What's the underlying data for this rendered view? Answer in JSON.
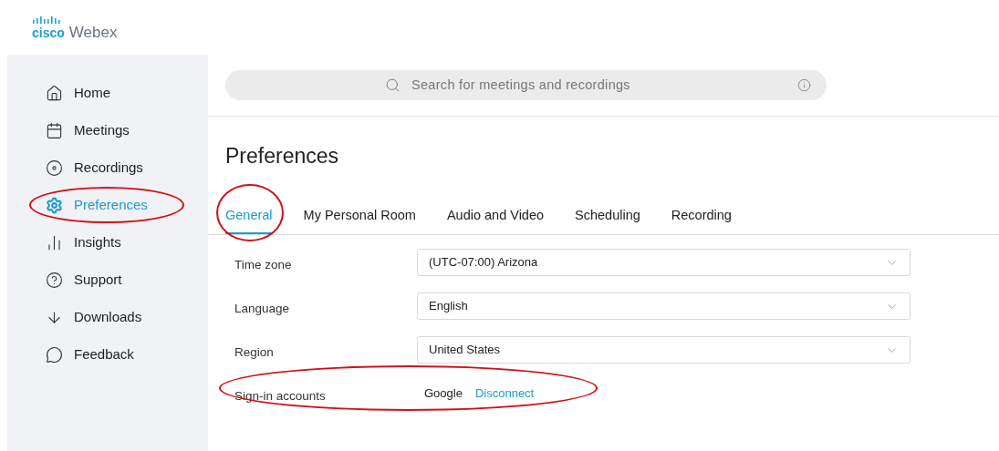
{
  "logo": {
    "brand": "cisco",
    "product": "Webex"
  },
  "sidebar": {
    "items": [
      {
        "label": "Home",
        "kind": "home",
        "selected": false,
        "highlighted": false
      },
      {
        "label": "Meetings",
        "kind": "calendar",
        "selected": false,
        "highlighted": false
      },
      {
        "label": "Recordings",
        "kind": "disc",
        "selected": false,
        "highlighted": false
      },
      {
        "label": "Preferences",
        "kind": "gear",
        "selected": true,
        "highlighted": true
      },
      {
        "label": "Insights",
        "kind": "chart",
        "selected": false,
        "highlighted": false
      },
      {
        "label": "Support",
        "kind": "help",
        "selected": false,
        "highlighted": false
      },
      {
        "label": "Downloads",
        "kind": "download",
        "selected": false,
        "highlighted": false
      },
      {
        "label": "Feedback",
        "kind": "chat",
        "selected": false,
        "highlighted": false
      }
    ]
  },
  "search": {
    "placeholder": "Search for meetings and recordings"
  },
  "page_title": "Preferences",
  "tabs": [
    {
      "label": "General",
      "selected": true,
      "highlighted": true
    },
    {
      "label": "My Personal Room",
      "selected": false,
      "highlighted": false
    },
    {
      "label": "Audio and Video",
      "selected": false,
      "highlighted": false
    },
    {
      "label": "Scheduling",
      "selected": false,
      "highlighted": false
    },
    {
      "label": "Recording",
      "selected": false,
      "highlighted": false
    }
  ],
  "settings": [
    {
      "label": "Time zone",
      "kind": "select",
      "value": "(UTC-07:00) Arizona",
      "highlighted": false
    },
    {
      "label": "Language",
      "kind": "select",
      "value": "English",
      "highlighted": false
    },
    {
      "label": "Region",
      "kind": "select",
      "value": "United States",
      "highlighted": false
    },
    {
      "label": "Sign-in accounts",
      "kind": "account",
      "value": "Google",
      "action": "Disconnect",
      "highlighted": true
    }
  ]
}
